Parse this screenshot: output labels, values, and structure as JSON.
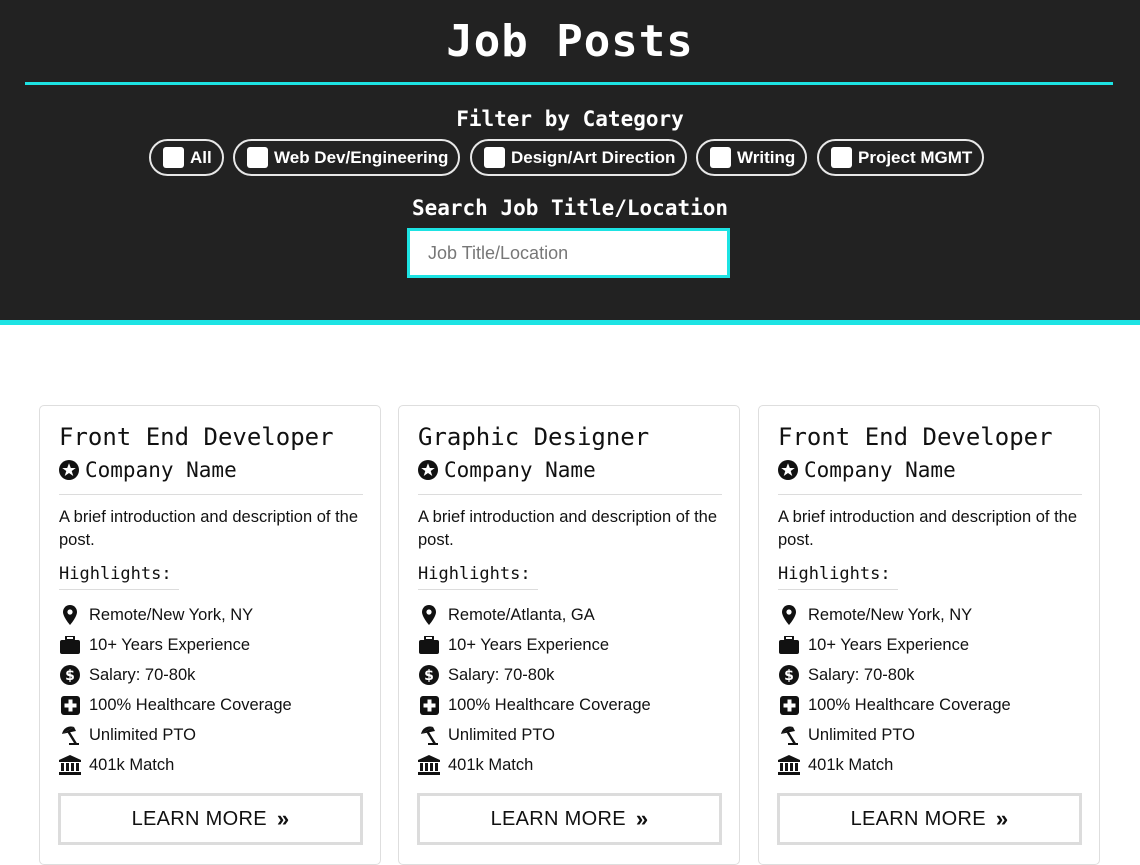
{
  "header": {
    "title": "Job Posts",
    "filter_label": "Filter by Category",
    "categories": [
      "All",
      "Web Dev/Engineering",
      "Design/Art Direction",
      "Writing",
      "Project MGMT"
    ],
    "search_label": "Search Job Title/Location",
    "search_placeholder": "Job Title/Location",
    "search_value": ""
  },
  "colors": {
    "header_bg": "#222222",
    "accent": "#1de3e3"
  },
  "cards": [
    {
      "title": "Front End Developer",
      "company": "Company Name",
      "description": "A brief introduction and description of the post.",
      "highlights_label": "Highlights:",
      "highlights": [
        {
          "icon": "location-pin-icon",
          "text": "Remote/New York, NY"
        },
        {
          "icon": "briefcase-icon",
          "text": "10+ Years Experience"
        },
        {
          "icon": "dollar-icon",
          "text": "Salary: 70-80k"
        },
        {
          "icon": "medical-plus-icon",
          "text": "100% Healthcare Coverage"
        },
        {
          "icon": "umbrella-beach-icon",
          "text": "Unlimited PTO"
        },
        {
          "icon": "bank-icon",
          "text": "401k Match"
        }
      ],
      "button_label": "LEARN MORE"
    },
    {
      "title": "Graphic Designer",
      "company": "Company Name",
      "description": "A brief introduction and description of the post.",
      "highlights_label": "Highlights:",
      "highlights": [
        {
          "icon": "location-pin-icon",
          "text": "Remote/Atlanta, GA"
        },
        {
          "icon": "briefcase-icon",
          "text": "10+ Years Experience"
        },
        {
          "icon": "dollar-icon",
          "text": "Salary: 70-80k"
        },
        {
          "icon": "medical-plus-icon",
          "text": "100% Healthcare Coverage"
        },
        {
          "icon": "umbrella-beach-icon",
          "text": "Unlimited PTO"
        },
        {
          "icon": "bank-icon",
          "text": "401k Match"
        }
      ],
      "button_label": "LEARN MORE"
    },
    {
      "title": "Front End Developer",
      "company": "Company Name",
      "description": "A brief introduction and description of the post.",
      "highlights_label": "Highlights:",
      "highlights": [
        {
          "icon": "location-pin-icon",
          "text": "Remote/New York, NY"
        },
        {
          "icon": "briefcase-icon",
          "text": "10+ Years Experience"
        },
        {
          "icon": "dollar-icon",
          "text": "Salary: 70-80k"
        },
        {
          "icon": "medical-plus-icon",
          "text": "100% Healthcare Coverage"
        },
        {
          "icon": "umbrella-beach-icon",
          "text": "Unlimited PTO"
        },
        {
          "icon": "bank-icon",
          "text": "401k Match"
        }
      ],
      "button_label": "LEARN MORE"
    }
  ]
}
